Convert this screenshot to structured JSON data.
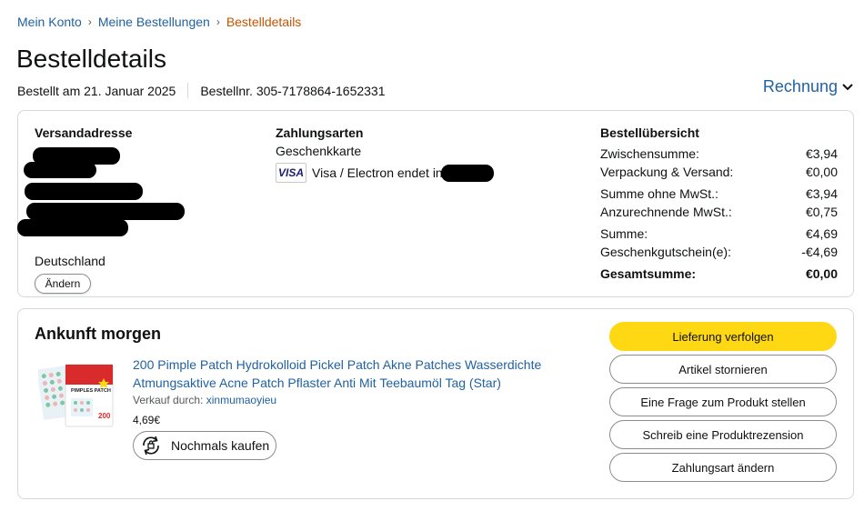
{
  "breadcrumb": {
    "items": [
      "Mein Konto",
      "Meine Bestellungen"
    ],
    "separator": "›",
    "current": "Bestelldetails"
  },
  "page_title": "Bestelldetails",
  "order_meta": {
    "ordered_on": "Bestellt am 21. Januar 2025",
    "order_number": "Bestellnr. 305-7178864-1652331"
  },
  "invoice_label": "Rechnung",
  "shipping": {
    "heading": "Versandadresse",
    "country": "Deutschland",
    "edit_label": "Ändern"
  },
  "payment": {
    "heading": "Zahlungsarten",
    "method_1": "Geschenkkarte",
    "card_logo": "VISA",
    "card_text": "Visa / Electron endet in"
  },
  "summary": {
    "heading": "Bestellübersicht",
    "rows": [
      {
        "label": "Zwischensumme:",
        "value": "€3,94"
      },
      {
        "label": "Verpackung & Versand:",
        "value": "€0,00"
      },
      {
        "label": "Summe ohne MwSt.:",
        "value": "€3,94"
      },
      {
        "label": "Anzurechnende MwSt.:",
        "value": "€0,75"
      },
      {
        "label": "Summe:",
        "value": "€4,69"
      },
      {
        "label": "Geschenkgutschein(e):",
        "value": "-€4,69"
      }
    ],
    "total": {
      "label": "Gesamtsumme:",
      "value": "€0,00"
    }
  },
  "shipment": {
    "arrival": "Ankunft morgen",
    "product": {
      "title": "200 Pimple Patch Hydrokolloid Pickel Patch Akne Patches Wasserdichte Atmungsaktive Acne Patch Pflaster Anti Mit Teebaumöl Tag (Star)",
      "sold_by_label": "Verkauf durch:",
      "seller": "xinmumaoyieu",
      "price": "4,69€",
      "image_text": "PIMPLES PATCH",
      "image_count": "200"
    },
    "buy_again_label": "Nochmals kaufen",
    "actions": [
      "Lieferung verfolgen",
      "Artikel stornieren",
      "Eine Frage zum Produkt stellen",
      "Schreib eine Produktrezension",
      "Zahlungsart ändern"
    ]
  },
  "colors": {
    "link": "#2162a1",
    "breadcrumb_current": "#c45500",
    "primary_button": "#ffd814",
    "border": "#d5d9d9"
  }
}
